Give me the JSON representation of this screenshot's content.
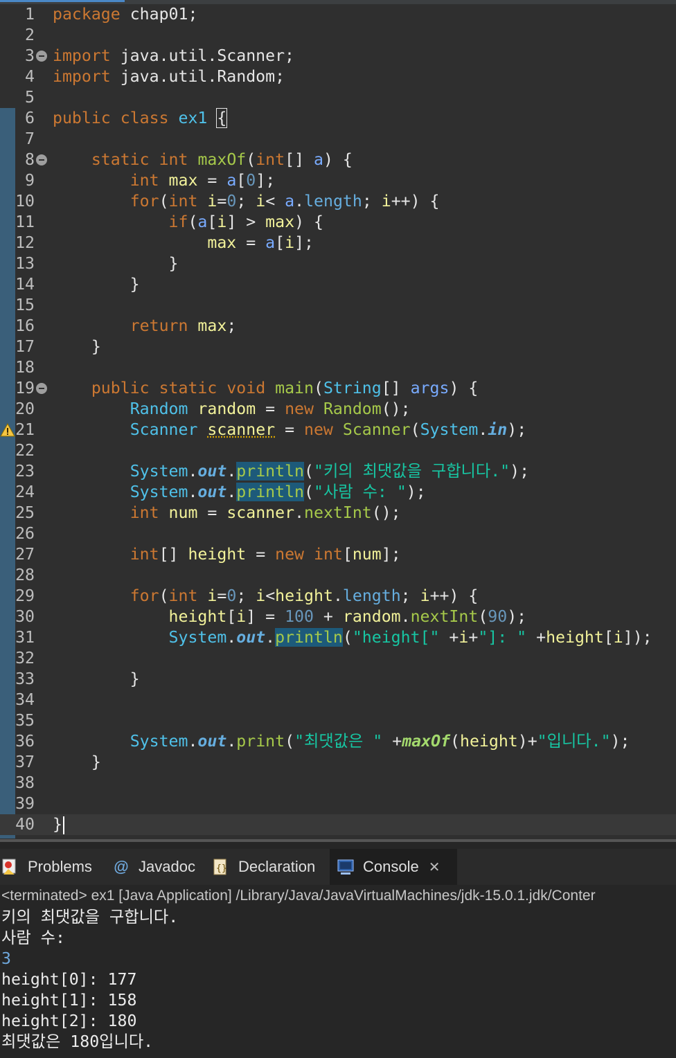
{
  "editor": {
    "lines": [
      {
        "n": "1"
      },
      {
        "n": "2"
      },
      {
        "n": "3"
      },
      {
        "n": "4"
      },
      {
        "n": "5"
      },
      {
        "n": "6"
      },
      {
        "n": "7"
      },
      {
        "n": "8"
      },
      {
        "n": "9"
      },
      {
        "n": "10"
      },
      {
        "n": "11"
      },
      {
        "n": "12"
      },
      {
        "n": "13"
      },
      {
        "n": "14"
      },
      {
        "n": "15"
      },
      {
        "n": "16"
      },
      {
        "n": "17"
      },
      {
        "n": "18"
      },
      {
        "n": "19"
      },
      {
        "n": "20"
      },
      {
        "n": "21"
      },
      {
        "n": "22"
      },
      {
        "n": "23"
      },
      {
        "n": "24"
      },
      {
        "n": "25"
      },
      {
        "n": "26"
      },
      {
        "n": "27"
      },
      {
        "n": "28"
      },
      {
        "n": "29"
      },
      {
        "n": "30"
      },
      {
        "n": "31"
      },
      {
        "n": "32"
      },
      {
        "n": "33"
      },
      {
        "n": "34"
      },
      {
        "n": "35"
      },
      {
        "n": "36"
      },
      {
        "n": "37"
      },
      {
        "n": "38"
      },
      {
        "n": "39"
      },
      {
        "n": "40"
      }
    ],
    "code": {
      "l1": [
        "package",
        " chap01;"
      ],
      "l3": [
        "import",
        " java.util.Scanner;"
      ],
      "l4": [
        "import",
        " java.util.Random;"
      ],
      "l6": [
        "public",
        " ",
        "class",
        " ",
        "ex1",
        " ",
        "{"
      ],
      "l8": [
        "    ",
        "static",
        " ",
        "int",
        " ",
        "maxOf",
        "(",
        "int",
        "[] ",
        "a",
        ") {"
      ],
      "l9": [
        "        ",
        "int",
        " ",
        "max",
        " = ",
        "a",
        "[",
        "0",
        "];"
      ],
      "l10": [
        "        ",
        "for",
        "(",
        "int",
        " ",
        "i",
        "=",
        "0",
        "; ",
        "i",
        "< ",
        "a",
        ".",
        "length",
        "; ",
        "i",
        "++) {"
      ],
      "l11": [
        "            ",
        "if",
        "(",
        "a",
        "[",
        "i",
        "] > ",
        "max",
        ") {"
      ],
      "l12": [
        "                ",
        "max",
        " = ",
        "a",
        "[",
        "i",
        "];"
      ],
      "l13": [
        "            }"
      ],
      "l14": [
        "        }"
      ],
      "l16": [
        "        ",
        "return",
        " ",
        "max",
        ";"
      ],
      "l17": [
        "    }"
      ],
      "l19": [
        "    ",
        "public",
        " ",
        "static",
        " ",
        "void",
        " ",
        "main",
        "(",
        "String",
        "[] ",
        "args",
        ") {"
      ],
      "l20": [
        "        ",
        "Random",
        " ",
        "random",
        " = ",
        "new",
        " ",
        "Random",
        "();"
      ],
      "l21": [
        "        ",
        "Scanner",
        " ",
        "scanner",
        " = ",
        "new",
        " ",
        "Scanner",
        "(",
        "System",
        ".",
        "in",
        ");"
      ],
      "l23": [
        "        ",
        "System",
        ".",
        "out",
        ".",
        "println",
        "(",
        "\"키의 최댓값을 구합니다.\"",
        ");"
      ],
      "l24": [
        "        ",
        "System",
        ".",
        "out",
        ".",
        "println",
        "(",
        "\"사람 수: \"",
        ");"
      ],
      "l25": [
        "        ",
        "int",
        " ",
        "num",
        " = ",
        "scanner",
        ".",
        "nextInt",
        "();"
      ],
      "l27": [
        "        ",
        "int",
        "[] ",
        "height",
        " = ",
        "new",
        " ",
        "int",
        "[",
        "num",
        "];"
      ],
      "l29": [
        "        ",
        "for",
        "(",
        "int",
        " ",
        "i",
        "=",
        "0",
        "; ",
        "i",
        "<",
        "height",
        ".",
        "length",
        "; ",
        "i",
        "++) {"
      ],
      "l30": [
        "            ",
        "height",
        "[",
        "i",
        "] = ",
        "100",
        " + ",
        "random",
        ".",
        "nextInt",
        "(",
        "90",
        ");"
      ],
      "l31": [
        "            ",
        "System",
        ".",
        "out",
        ".",
        "println",
        "(",
        "\"height[\"",
        " +",
        "i",
        "+",
        "\"]: \"",
        " +",
        "height",
        "[",
        "i",
        "]);"
      ],
      "l33": [
        "        }"
      ],
      "l36": [
        "        ",
        "System",
        ".",
        "out",
        ".",
        "print",
        "(",
        "\"최댓값은 \"",
        " +",
        "maxOf",
        "(",
        "height",
        ")+",
        "\"입니다.\"",
        ");"
      ],
      "l37": [
        "    }"
      ],
      "l40": [
        "}"
      ]
    }
  },
  "panel": {
    "tabs": [
      {
        "label": "Problems",
        "icon": "problems-icon"
      },
      {
        "label": "Javadoc",
        "icon": "javadoc-icon"
      },
      {
        "label": "Declaration",
        "icon": "declaration-icon"
      },
      {
        "label": "Console",
        "icon": "console-icon",
        "close": "✕"
      }
    ],
    "console_info": "<terminated> ex1 [Java Application] /Library/Java/JavaVirtualMachines/jdk-15.0.1.jdk/Conter",
    "output": [
      "키의 최댓값을 구합니다.",
      "사람 수:",
      "3",
      "height[0]: 177",
      "height[1]: 158",
      "height[2]: 180",
      "최댓값은 180입니다."
    ]
  }
}
